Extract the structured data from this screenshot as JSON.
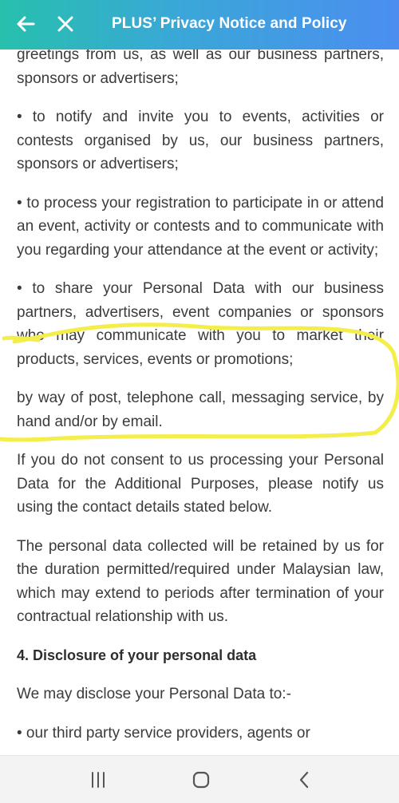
{
  "header": {
    "title": "PLUS’ Privacy Notice and Policy",
    "back_icon": "back-arrow-icon",
    "close_icon": "close-icon"
  },
  "content": {
    "p1": "greetings from us, as well as our business partners, sponsors or advertisers;",
    "p2": "• to notify and invite you to events, activities or contests organised by us, our business partners, sponsors or advertisers;",
    "p3": "• to process your registration to participate in or attend an event, activity or contests and to communicate with you regarding your attendance at the event or activity;",
    "p4": "• to share your Personal Data with our business partners, advertisers, event companies or sponsors who may communicate with you to market their products, services, events or promotions;",
    "p5": "by way of post, telephone call, messaging service, by hand and/or by email.",
    "p6": "If you do not consent to us processing your Personal Data for the Additional Purposes, please notify us using the contact details stated below.",
    "p7": "The personal data collected will be retained by us for the duration permitted/required under Malaysian law, which may extend to periods after termination of your contractual relationship with us.",
    "h4": "4. Disclosure of your personal data",
    "p8": "We may disclose your Personal Data to:-",
    "p9": "• our third party service providers, agents or"
  },
  "annotation": {
    "color": "#f3ee4a"
  },
  "navbar": {
    "recents_icon": "recents-icon",
    "home_icon": "home-icon",
    "back_icon": "back-chevron-icon"
  }
}
